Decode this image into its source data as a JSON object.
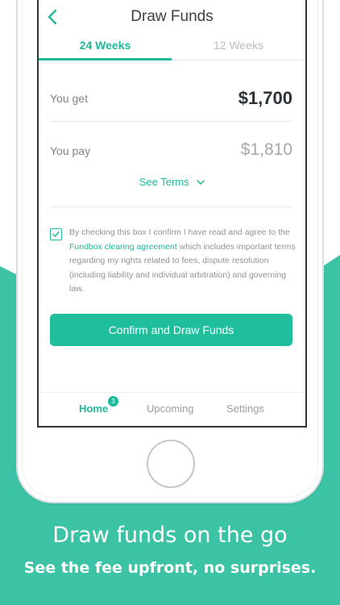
{
  "header": {
    "title": "Draw Funds"
  },
  "tabs": [
    {
      "label": "24 Weeks",
      "active": true
    },
    {
      "label": "12 Weeks",
      "active": false
    }
  ],
  "summary": {
    "get_label": "You get",
    "get_value": "$1,700",
    "pay_label": "You pay",
    "pay_value": "$1,810",
    "see_terms": "See Terms"
  },
  "agreement": {
    "checked": true,
    "text_before": "By checking this box I confirm I have read and agree to the ",
    "link": "Fundbox clearing agreement",
    "text_after": " which includes important terms regarding my rights related to fees, dispute resolution (including liability and individual arbitration) and governing law."
  },
  "cta": {
    "label": "Confirm and Draw Funds"
  },
  "bottom_nav": {
    "home": "Home",
    "home_badge": "3",
    "upcoming": "Upcoming",
    "settings": "Settings"
  },
  "promo": {
    "title": "Draw funds on the go",
    "subtitle": "See the fee upfront, no surprises."
  },
  "colors": {
    "accent": "#1fb89a",
    "button": "#1fbf9d",
    "promo_bg": "#3cc3a5"
  },
  "icons": [
    "back-chevron-icon",
    "chevron-down-icon",
    "checkmark-icon"
  ]
}
